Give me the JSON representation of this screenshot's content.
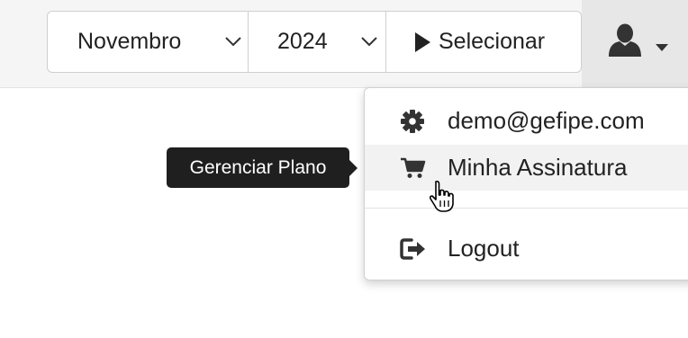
{
  "header": {
    "month_select": {
      "value": "Novembro"
    },
    "year_select": {
      "value": "2024"
    },
    "select_button_label": "Selecionar"
  },
  "user_menu": {
    "items": [
      {
        "label": "demo@gefipe.com",
        "icon": "gear-icon"
      },
      {
        "label": "Minha Assinatura",
        "icon": "cart-icon"
      },
      {
        "label": "Logout",
        "icon": "logout-icon"
      }
    ]
  },
  "tooltip": {
    "text": "Gerenciar Plano"
  },
  "colors": {
    "topbar_bg": "#f5f5f5",
    "user_area_bg": "#e7e7e7",
    "tooltip_bg": "#1f1f1f",
    "hover_bg": "#f2f2f2",
    "icon": "#333333"
  }
}
